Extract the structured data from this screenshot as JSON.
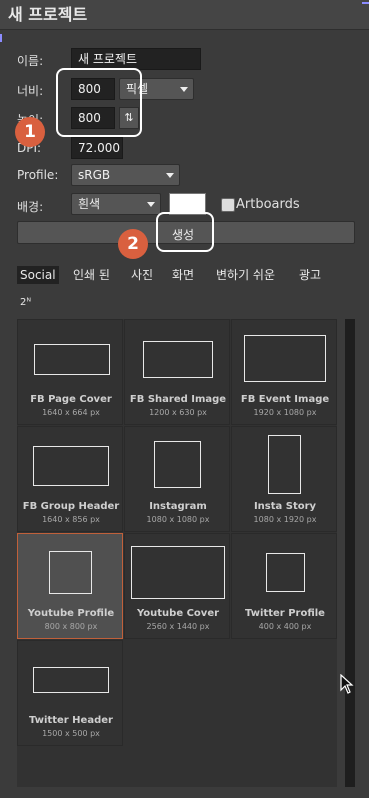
{
  "window": {
    "title": "새 프로젝트"
  },
  "form": {
    "name_label": "이름:",
    "name_value": "새 프로젝트",
    "width_label": "너비:",
    "width_value": "800",
    "unit_value": "픽셀",
    "height_label": "높이:",
    "height_value": "800",
    "swap_icon": "swap-icon",
    "dpi_label": "DPI:",
    "dpi_value": "72.000",
    "profile_label": "Profile:",
    "profile_value": "sRGB",
    "background_label": "배경:",
    "background_value": "흰색",
    "background_color": "#ffffff",
    "artboards_label": "Artboards",
    "create_label": "생성"
  },
  "annotations": {
    "badge1": "1",
    "badge2": "2",
    "badge_color": "#d9603f"
  },
  "tabs": [
    "Social",
    "인쇄 된",
    "사진",
    "화면",
    "변하기 쉬운",
    "광고",
    "2ᴺ"
  ],
  "presets": [
    {
      "name": "FB Page Cover",
      "size": "1640 x 664 px"
    },
    {
      "name": "FB Shared Image",
      "size": "1200 x 630 px"
    },
    {
      "name": "FB Event Image",
      "size": "1920 x 1080 px"
    },
    {
      "name": "FB Group Header",
      "size": "1640 x 856 px"
    },
    {
      "name": "Instagram",
      "size": "1080 x 1080 px"
    },
    {
      "name": "Insta Story",
      "size": "1080 x 1920 px"
    },
    {
      "name": "Youtube Profile",
      "size": "800 x 800 px"
    },
    {
      "name": "Youtube Cover",
      "size": "2560 x 1440 px"
    },
    {
      "name": "Twitter Profile",
      "size": "400 x 400 px"
    },
    {
      "name": "Twitter Header",
      "size": "1500 x 500 px"
    }
  ]
}
